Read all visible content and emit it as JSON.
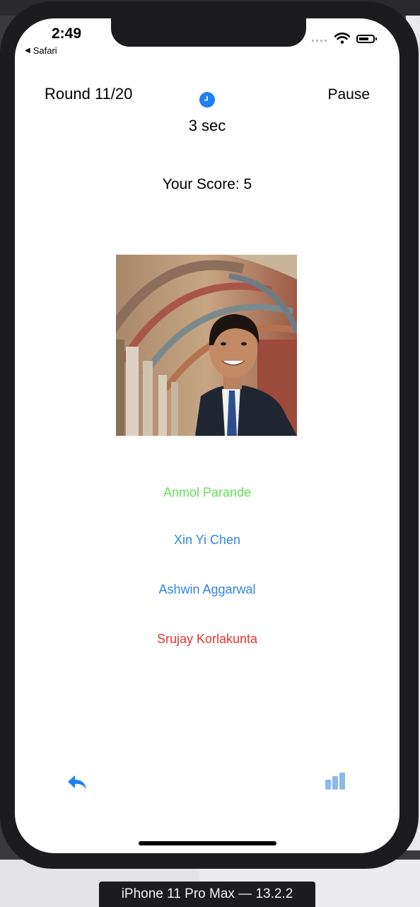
{
  "status_bar": {
    "time": "2:49",
    "back_label": "Safari"
  },
  "game": {
    "round_label": "Round 11/20",
    "pause_label": "Pause",
    "timer_text": "3 sec",
    "score_text": "Your Score: 5"
  },
  "answers": [
    {
      "label": "Anmol Parande",
      "color": "#66e05a"
    },
    {
      "label": "Xin Yi Chen",
      "color": "#2f86e6"
    },
    {
      "label": "Ashwin Aggarwal",
      "color": "#2f86e6"
    },
    {
      "label": "Srujay Korlakunta",
      "color": "#e5352b"
    }
  ],
  "toolbar": {
    "back_icon": "reply-arrow-icon",
    "stats_icon": "bar-chart-icon"
  },
  "colors": {
    "accent": "#1e7ff0",
    "stats_icon": "#8ab9ee"
  },
  "simulator_label": "iPhone 11 Pro Max — 13.2.2"
}
